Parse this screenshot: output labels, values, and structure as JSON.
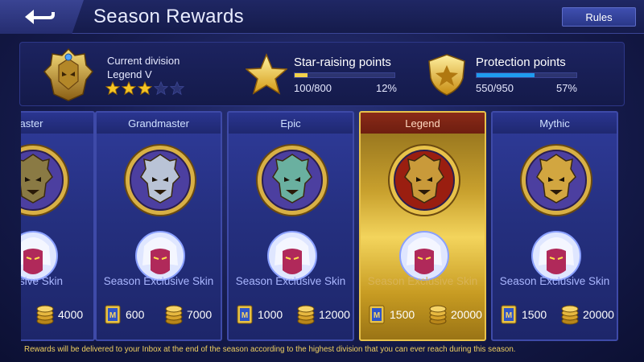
{
  "header": {
    "title": "Season Rewards",
    "rules_label": "Rules",
    "back_icon": "back-arrow-icon"
  },
  "status": {
    "division_label": "Current division",
    "division_name": "Legend V",
    "stars_filled": 3,
    "stars_total": 5,
    "star_points": {
      "title": "Star-raising points",
      "value": "100/800",
      "percent": "12%",
      "fraction": 0.125,
      "color": "#f3d24a"
    },
    "protection_points": {
      "title": "Protection points",
      "value": "550/950",
      "percent": "57%",
      "fraction": 0.579,
      "color": "#1f9cf0"
    }
  },
  "cards": [
    {
      "title": "aster",
      "skin": "xclusive Skin",
      "rewards": [
        {
          "type": "coin",
          "amount": "4000"
        }
      ],
      "theme": "blue"
    },
    {
      "title": "Grandmaster",
      "skin": "Season Exclusive Skin",
      "rewards": [
        {
          "type": "ticket",
          "amount": "600"
        },
        {
          "type": "coin",
          "amount": "7000"
        }
      ],
      "theme": "blue"
    },
    {
      "title": "Epic",
      "skin": "Season Exclusive Skin",
      "rewards": [
        {
          "type": "ticket",
          "amount": "1000"
        },
        {
          "type": "coin",
          "amount": "12000"
        }
      ],
      "theme": "blue"
    },
    {
      "title": "Legend",
      "skin": "Season Exclusive Skin",
      "rewards": [
        {
          "type": "ticket",
          "amount": "1500"
        },
        {
          "type": "coin",
          "amount": "20000"
        }
      ],
      "theme": "gold"
    },
    {
      "title": "Mythic",
      "skin": "Season Exclusive Skin",
      "rewards": [
        {
          "type": "ticket",
          "amount": "1500"
        },
        {
          "type": "coin",
          "amount": "20000"
        }
      ],
      "theme": "blue"
    }
  ],
  "footer": "Rewards will be delivered to your Inbox at the end of the season according to the highest division that you can ever reach during this season."
}
